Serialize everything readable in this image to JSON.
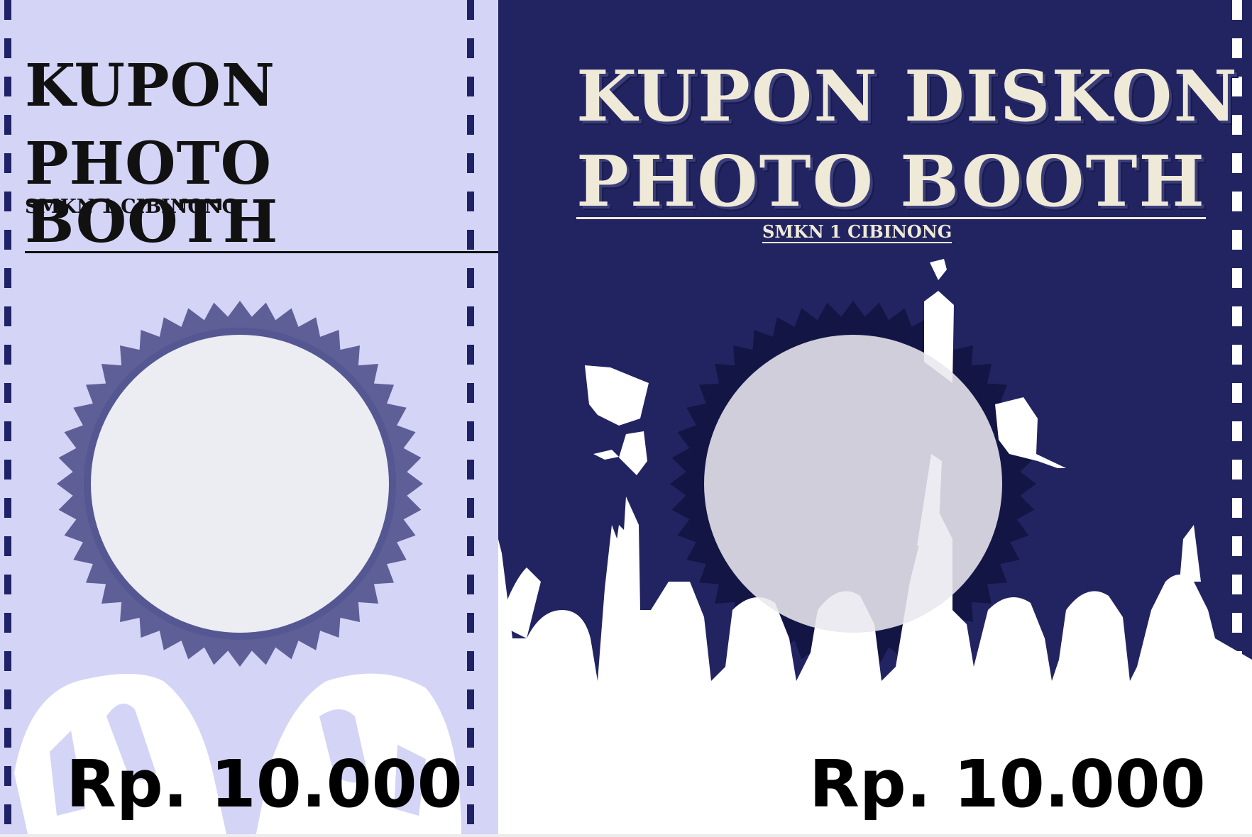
{
  "stub": {
    "title_line1": "KUPON",
    "title_line2": "PHOTO BOOTH",
    "school": "SMKN 1 CIBINONG",
    "price": "Rp. 10.000",
    "colors": {
      "background": "#d4d4f7",
      "seal": "#5e5f97",
      "perforation": "#1f2266"
    }
  },
  "coupon": {
    "title_line1": "KUPON DISKON",
    "title_line2": "PHOTO BOOTH",
    "school": "SMKN 1 CIBINONG",
    "price": "Rp. 10.000",
    "colors": {
      "background": "#222462",
      "title": "#efe9d8",
      "seal": "#131545",
      "perforation": "#ffffff"
    }
  },
  "icons": [
    "badge-seal-icon",
    "graduation-cap-icon",
    "graduates-silhouette-icon"
  ]
}
